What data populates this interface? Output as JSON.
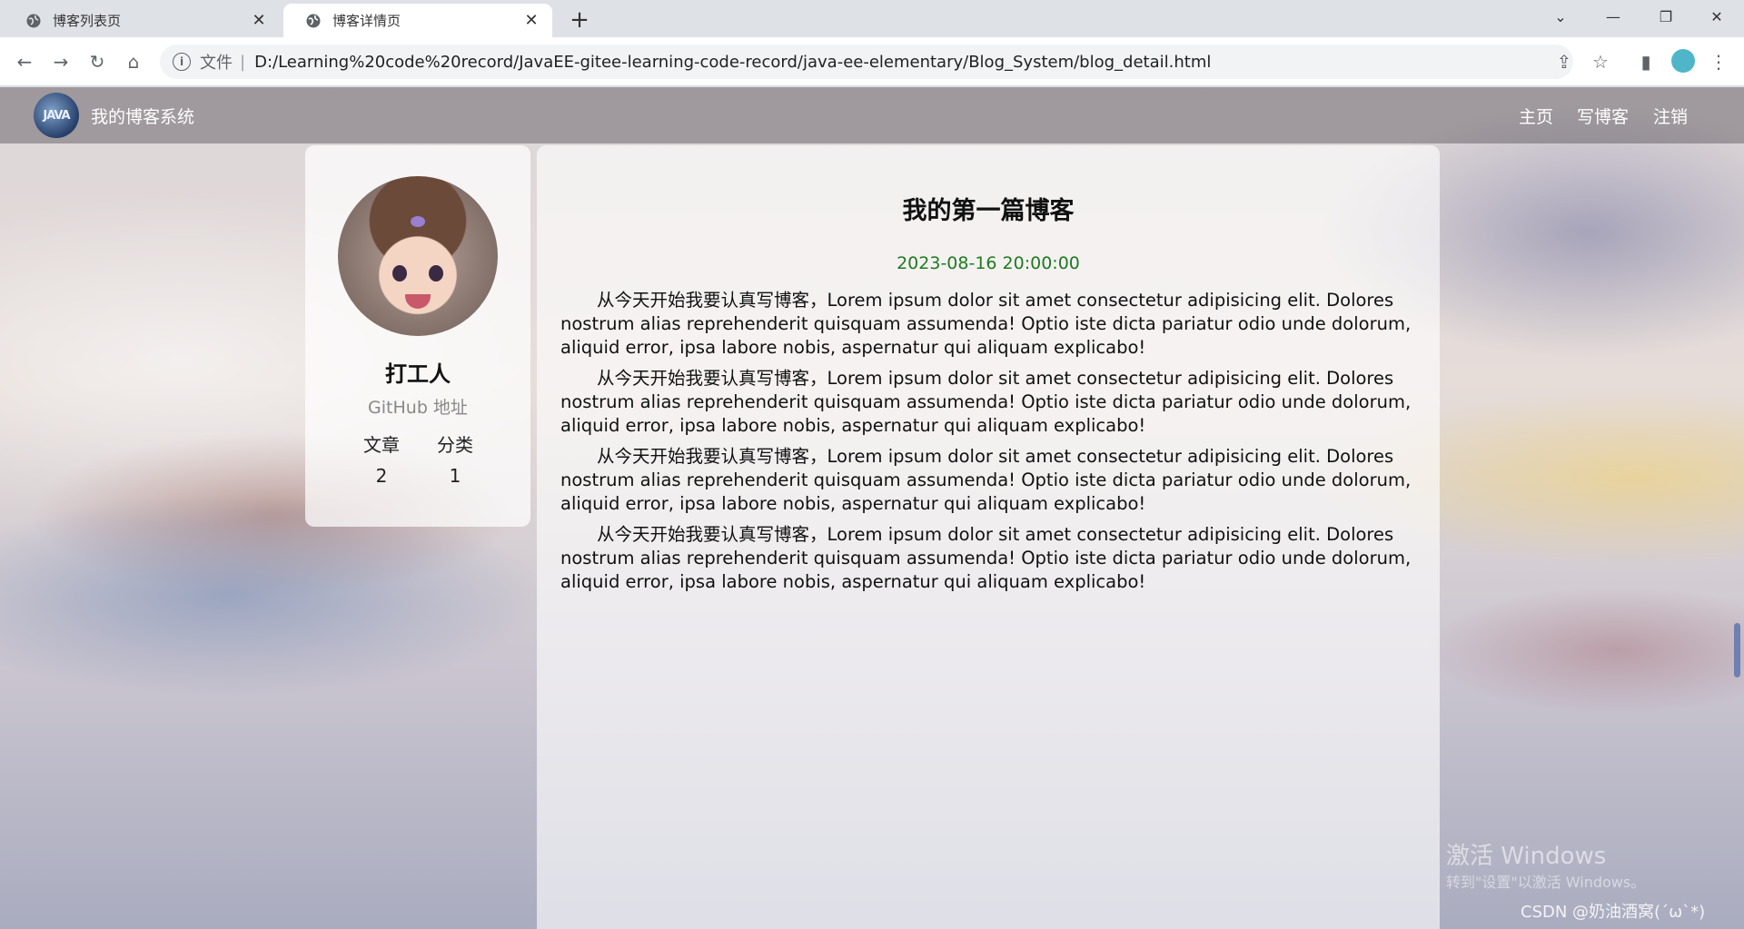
{
  "browser": {
    "tabs": [
      {
        "title": "博客列表页",
        "active": false
      },
      {
        "title": "博客详情页",
        "active": true
      }
    ],
    "address": {
      "scheme": "文件",
      "url": "D:/Learning%20code%20record/JavaEE-gitee-learning-code-record/java-ee-elementary/Blog_System/blog_detail.html"
    }
  },
  "nav": {
    "logo_text": "JAVA",
    "site_title": "我的博客系统",
    "links": [
      "主页",
      "写博客",
      "注销"
    ]
  },
  "profile": {
    "name": "打工人",
    "github": "GitHub 地址",
    "stats": [
      {
        "label": "文章",
        "value": "2"
      },
      {
        "label": "分类",
        "value": "1"
      }
    ]
  },
  "article": {
    "title": "我的第一篇博客",
    "date": "2023-08-16 20:00:00",
    "paragraphs": [
      "从今天开始我要认真写博客，Lorem ipsum dolor sit amet consectetur adipisicing elit. Dolores nostrum alias reprehenderit quisquam assumenda! Optio iste dicta pariatur odio unde dolorum, aliquid error, ipsa labore nobis, aspernatur qui aliquam explicabo!",
      "从今天开始我要认真写博客，Lorem ipsum dolor sit amet consectetur adipisicing elit. Dolores nostrum alias reprehenderit quisquam assumenda! Optio iste dicta pariatur odio unde dolorum, aliquid error, ipsa labore nobis, aspernatur qui aliquam explicabo!",
      "从今天开始我要认真写博客，Lorem ipsum dolor sit amet consectetur adipisicing elit. Dolores nostrum alias reprehenderit quisquam assumenda! Optio iste dicta pariatur odio unde dolorum, aliquid error, ipsa labore nobis, aspernatur qui aliquam explicabo!",
      "从今天开始我要认真写博客，Lorem ipsum dolor sit amet consectetur adipisicing elit. Dolores nostrum alias reprehenderit quisquam assumenda! Optio iste dicta pariatur odio unde dolorum, aliquid error, ipsa labore nobis, aspernatur qui aliquam explicabo!"
    ]
  },
  "overlay": {
    "activation_title": "激活 Windows",
    "activation_hint": "转到\"设置\"以激活 Windows。",
    "csdn_watermark": "CSDN @奶油酒窝(´ω`*)"
  }
}
